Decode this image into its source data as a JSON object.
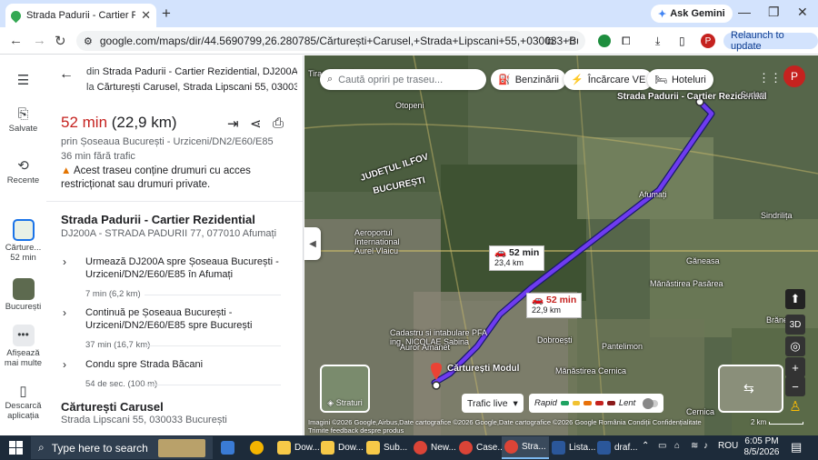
{
  "browser": {
    "tab_title": "Strada Padurii - Cartier Rezidential",
    "tab_close": "✕",
    "new_tab": "+",
    "gemini_label": "Ask Gemini",
    "url": "google.com/maps/dir/44.5690799,26.280785/Cărturești+Carusel,+Strada+Lipscani+55,+030033+București/...",
    "relaunch_label": "Relaunch to update",
    "min": "—",
    "max": "❐",
    "close": "✕"
  },
  "rail": {
    "saved": "Salvate",
    "recent": "Recente",
    "car_thumb_label": "Cărture...",
    "car_thumb_time": "52 min",
    "bucharest_label": "București",
    "more_label": "Afișează mai multe",
    "download_label": "Descarcă aplicația"
  },
  "panel": {
    "from_prefix": "din",
    "from": "Strada Padurii - Cartier Rezidential, DJ200A...",
    "to_prefix": "la",
    "to": "Cărturești Carusel, Strada Lipscani 55, 03003...",
    "time": "52 min",
    "distance": "(22,9 km)",
    "via": "prin Șoseaua București - Urziceni/DN2/E60/E85",
    "no_traffic": "36 min fără trafic",
    "warning": "Acest traseu conține drumuri cu acces restricționat sau drumuri private.",
    "origin_name": "Strada Padurii - Cartier Rezidential",
    "origin_addr": "DJ200A - STRADA PADURII 77, 077010 Afumați",
    "steps": [
      {
        "text": "Urmează DJ200A spre Șoseaua București - Urziceni/DN2/E60/E85 în Afumați",
        "dist": "7 min (6,2 km)"
      },
      {
        "text": "Continuă pe Șoseaua București - Urziceni/DN2/E60/E85 spre București",
        "dist": "37 min (16,7 km)"
      },
      {
        "text": "Condu spre Strada Băcani",
        "dist": "54 de sec. (100 m)"
      }
    ],
    "dest_name": "Cărturești Carusel",
    "dest_addr": "Strada Lipscani 55, 030033 București"
  },
  "map": {
    "search_placeholder": "Caută opriri pe traseu...",
    "chips": [
      "Benzinării",
      "Încărcare VE",
      "Hoteluri"
    ],
    "avatar_letter": "P",
    "bubble1": {
      "time": "52 min",
      "dist": "23,4 km"
    },
    "bubble2": {
      "time": "52 min",
      "dist": "22,9 km"
    },
    "labels": {
      "origin": "Strada Padurii - Cartier Rezidential",
      "judetul": "JUDEȚUL ILFOV",
      "bucuresti_big": "BUCUREȘTI",
      "afumati": "Afumați",
      "airport": "Aeroportul International Aurel Vlaicu",
      "dest": "Cărturești Modul",
      "cadastru": "Cadastru si intabulare PFA ing. NICOLAE Sabina",
      "auror": "Auror Amanet",
      "manastirea_pasarea": "Mănăstirea Pasărea",
      "manastirea_cernica": "Mănăstirea Cernica",
      "ganeasa": "Găneasa",
      "dobroesti": "Dobroești",
      "pantelimon": "Pantelimon",
      "cernica": "Cernica",
      "sindrilita": "Sindrilița",
      "otopeni": "Otopeni",
      "tirac": "Tirac Colection",
      "surlari": "Surlari",
      "branesti": "Brăneș"
    },
    "layers_label": "Straturi",
    "traffic_label": "Trafic live",
    "legend_fast": "Rapid",
    "legend_slow": "Lent",
    "ctl_3d": "3D",
    "attribution": "Imagini ©2026 Google,Airbus,Date cartografice ©2026 Google,Date cartografice ©2026 Google   România   Condiții   Confidențialitate",
    "attribution2": "Trimite feedback despre produs",
    "scale": "2 km"
  },
  "taskbar": {
    "search": "Type here to search",
    "apps": [
      "Dow...",
      "Dow...",
      "Sub...",
      "New...",
      "Case...",
      "Stra...",
      "Lista...",
      "draf..."
    ],
    "lang": "ROU",
    "time": "6:05 PM",
    "date": "8/5/2026"
  },
  "colors": {
    "route": "#6e3bf0",
    "accent": "#c5221f",
    "traffic": [
      "#1ea362",
      "#f1c232",
      "#e8710a",
      "#c5221f",
      "#8b1a1a"
    ]
  }
}
